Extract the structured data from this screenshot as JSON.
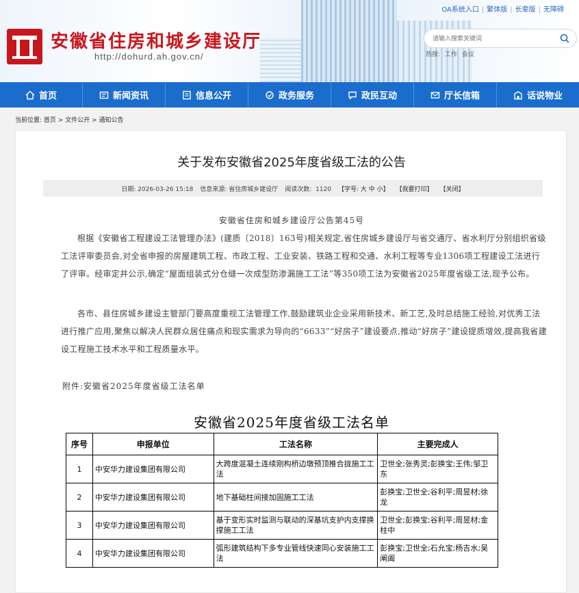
{
  "header": {
    "site_title": "安徽省住房和城乡建设厅",
    "site_url": "http://dohurd.ah.gov.cn/",
    "top_links": [
      "OA系统入口",
      "繁体版",
      "长辈版",
      "无障碍"
    ],
    "search_placeholder": "请输入搜索关键词",
    "hot_label": "热搜:",
    "hot_items": [
      "工作",
      "会议"
    ]
  },
  "nav": {
    "items": [
      {
        "label": "首页",
        "icon": "home-icon"
      },
      {
        "label": "新闻资讯",
        "icon": "news-icon"
      },
      {
        "label": "信息公开",
        "icon": "document-icon"
      },
      {
        "label": "政务服务",
        "icon": "service-icon"
      },
      {
        "label": "政民互动",
        "icon": "chat-icon"
      },
      {
        "label": "厅长信箱",
        "icon": "mailbox-icon"
      },
      {
        "label": "话说物业",
        "icon": "property-icon"
      }
    ]
  },
  "breadcrumb": {
    "prefix": "当前位置:",
    "items": [
      "首页",
      "文件公开",
      "通知公告"
    ],
    "sep": " > "
  },
  "article": {
    "title": "关于发布安徽省2025年度省级工法的公告",
    "meta": {
      "date": "日期: 2026-03-26 15:18",
      "source": "信息来源: 省住房城乡建设厅",
      "reads_label": "阅读次数:",
      "reads": "1120",
      "font_size": "【字号: 大 中 小】",
      "print": "【我要打印】",
      "close": "【关闭】"
    },
    "subtitle": "安徽省住房和城乡建设厅公告第45号",
    "para1": "根据《安徽省工程建设工法管理办法》(建质〔2018〕163号)相关规定,省住房城乡建设厅与省交通厅、省水利厅分别组织省级工法评审委员会,对全省申报的房屋建筑工程、市政工程、工业安装、铁路工程和交通、水利工程等专业1306项工程建设工法进行了评审。经审定并公示,确定“屋面组装式分仓缝一次成型防渗漏施工工法”等350项工法为安徽省2025年度省级工法,现予公布。",
    "para2": "各市、县住房城乡建设主管部门要高度重视工法管理工作,鼓励建筑业企业采用新技术、新工艺,及时总结施工经验,对优秀工法进行推广应用,聚焦以解决人民群众居住痛点和现实需求为导向的“6633”“好房子”建设要点,推动“好房子”建设提质增效,提高我省建设工程施工技术水平和工程质量水平。",
    "attachment": "附件:安徽省2025年度省级工法名单"
  },
  "table": {
    "title": "安徽省2025年度省级工法名单",
    "headers": [
      "序号",
      "申报单位",
      "工法名称",
      "主要完成人"
    ],
    "rows": [
      [
        "1",
        "中安华力建设集团有限公司",
        "大跨度混凝土连续刚构桥边墩预顶推合拢施工工法",
        "卫世全;张秀灵;彭换宝;王伟;邹卫东"
      ],
      [
        "2",
        "中安华力建设集团有限公司",
        "地下基础柱间接加固施工工法",
        "彭换宝;卫世全;谷利平;周昱材;徐龙"
      ],
      [
        "3",
        "中安华力建设集团有限公司",
        "基于变形实时监测与联动的深基坑支护内支撑换撑施工工法",
        "卫世全;彭换宝;谷利平;周昱材;金柱中"
      ],
      [
        "4",
        "中安华力建设集团有限公司",
        "弧形建筑结构下多专业管线快速同心安装施工工法",
        "彭换宝;卫世全;石允宝;杨吉水;吴阐阖"
      ]
    ]
  },
  "colors": {
    "brand_red": "#c8161d",
    "nav_blue": "#1a6dcc",
    "link_blue": "#2a68c8"
  }
}
